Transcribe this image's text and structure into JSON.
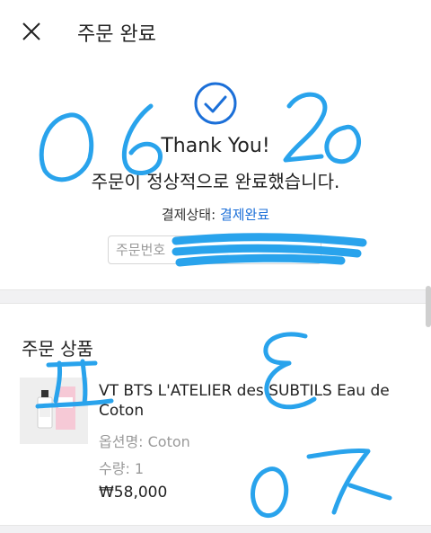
{
  "header": {
    "title": "주문 완료"
  },
  "confirmation": {
    "thanks": "Thank You!",
    "message": "주문이 정상적으로 완료했습니다.",
    "status_label": "결제상태:",
    "status_value": "결제완료",
    "order_number_label": "주문번호"
  },
  "order_items": {
    "section_title": "주문 상품",
    "item": {
      "name": "VT BTS L'ATELIER des SUBTILS Eau de Coton",
      "option": "옵션명: Coton",
      "quantity": "수량: 1",
      "price": "₩58,000"
    }
  },
  "handwriting": [
    "0",
    "6",
    "2",
    "0",
    "표",
    "E",
    "0",
    "7"
  ],
  "colors": {
    "accent": "#1b6fd8",
    "scribble": "#29a3ec"
  }
}
